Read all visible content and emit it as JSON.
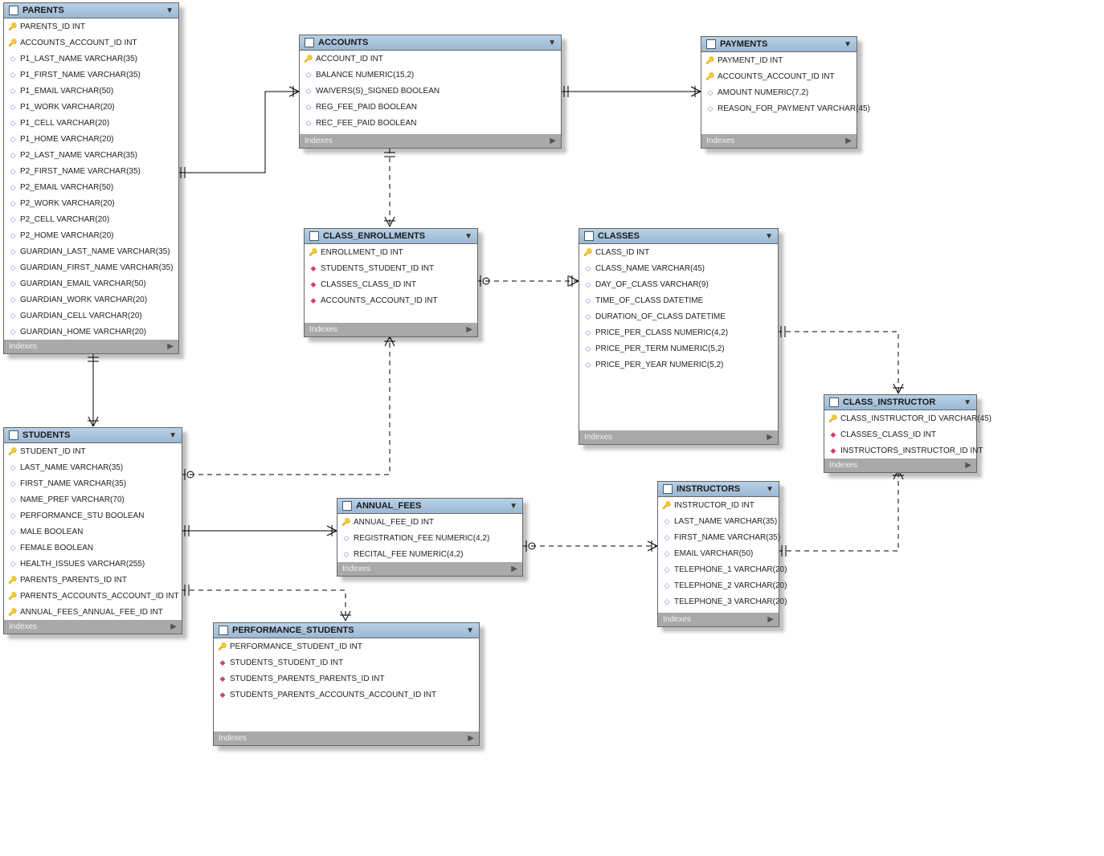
{
  "indexes_label": "Indexes",
  "tables": {
    "parents": {
      "title": "PARENTS",
      "columns": [
        {
          "icon": "pk",
          "label": "PARENTS_ID INT"
        },
        {
          "icon": "fk",
          "label": "ACCOUNTS_ACCOUNT_ID INT"
        },
        {
          "icon": "attr",
          "label": "P1_LAST_NAME VARCHAR(35)"
        },
        {
          "icon": "attr",
          "label": "P1_FIRST_NAME VARCHAR(35)"
        },
        {
          "icon": "attr",
          "label": "P1_EMAIL VARCHAR(50)"
        },
        {
          "icon": "attr",
          "label": "P1_WORK VARCHAR(20)"
        },
        {
          "icon": "attr",
          "label": "P1_CELL VARCHAR(20)"
        },
        {
          "icon": "attr",
          "label": "P1_HOME VARCHAR(20)"
        },
        {
          "icon": "attr",
          "label": "P2_LAST_NAME VARCHAR(35)"
        },
        {
          "icon": "attr",
          "label": "P2_FIRST_NAME VARCHAR(35)"
        },
        {
          "icon": "attr",
          "label": "P2_EMAIL VARCHAR(50)"
        },
        {
          "icon": "attr",
          "label": "P2_WORK VARCHAR(20)"
        },
        {
          "icon": "attr",
          "label": "P2_CELL VARCHAR(20)"
        },
        {
          "icon": "attr",
          "label": "P2_HOME VARCHAR(20)"
        },
        {
          "icon": "attr",
          "label": "GUARDIAN_LAST_NAME VARCHAR(35)"
        },
        {
          "icon": "attr",
          "label": "GUARDIAN_FIRST_NAME VARCHAR(35)"
        },
        {
          "icon": "attr",
          "label": "GUARDIAN_EMAIL VARCHAR(50)"
        },
        {
          "icon": "attr",
          "label": "GUARDIAN_WORK VARCHAR(20)"
        },
        {
          "icon": "attr",
          "label": "GUARDIAN_CELL VARCHAR(20)"
        },
        {
          "icon": "attr",
          "label": "GUARDIAN_HOME VARCHAR(20)"
        }
      ]
    },
    "accounts": {
      "title": "ACCOUNTS",
      "columns": [
        {
          "icon": "pk",
          "label": "ACCOUNT_ID INT"
        },
        {
          "icon": "attr",
          "label": "BALANCE NUMERIC(15,2)"
        },
        {
          "icon": "attr",
          "label": "WAIVERS(S)_SIGNED BOOLEAN"
        },
        {
          "icon": "attr",
          "label": "REG_FEE_PAID BOOLEAN"
        },
        {
          "icon": "attr",
          "label": "REC_FEE_PAID BOOLEAN"
        }
      ]
    },
    "payments": {
      "title": "PAYMENTS",
      "columns": [
        {
          "icon": "pk",
          "label": "PAYMENT_ID INT"
        },
        {
          "icon": "fk",
          "label": "ACCOUNTS_ACCOUNT_ID INT"
        },
        {
          "icon": "attr",
          "label": "AMOUNT NUMERIC(7,2)"
        },
        {
          "icon": "attr",
          "label": "REASON_FOR_PAYMENT VARCHAR(45)"
        }
      ]
    },
    "class_enrollments": {
      "title": "CLASS_ENROLLMENTS",
      "columns": [
        {
          "icon": "pk",
          "label": "ENROLLMENT_ID INT"
        },
        {
          "icon": "fkd",
          "label": "STUDENTS_STUDENT_ID INT"
        },
        {
          "icon": "fkd",
          "label": "CLASSES_CLASS_ID INT"
        },
        {
          "icon": "fkd",
          "label": "ACCOUNTS_ACCOUNT_ID INT"
        }
      ]
    },
    "classes": {
      "title": "CLASSES",
      "columns": [
        {
          "icon": "pk",
          "label": "CLASS_ID INT"
        },
        {
          "icon": "attr",
          "label": "CLASS_NAME VARCHAR(45)"
        },
        {
          "icon": "attr",
          "label": "DAY_OF_CLASS VARCHAR(9)"
        },
        {
          "icon": "attr",
          "label": "TIME_OF_CLASS DATETIME"
        },
        {
          "icon": "attr",
          "label": "DURATION_OF_CLASS DATETIME"
        },
        {
          "icon": "attr",
          "label": "PRICE_PER_CLASS NUMERIC(4,2)"
        },
        {
          "icon": "attr",
          "label": "PRICE_PER_TERM NUMERIC(5,2)"
        },
        {
          "icon": "attr",
          "label": "PRICE_PER_YEAR NUMERIC(5,2)"
        }
      ]
    },
    "class_instructor": {
      "title": "CLASS_INSTRUCTOR",
      "columns": [
        {
          "icon": "pk",
          "label": "CLASS_INSTRUCTOR_ID VARCHAR(45)"
        },
        {
          "icon": "fkd",
          "label": "CLASSES_CLASS_ID INT"
        },
        {
          "icon": "fkd",
          "label": "INSTRUCTORS_INSTRUCTOR_ID INT"
        }
      ]
    },
    "students": {
      "title": "STUDENTS",
      "columns": [
        {
          "icon": "pk",
          "label": "STUDENT_ID INT"
        },
        {
          "icon": "attr",
          "label": "LAST_NAME VARCHAR(35)"
        },
        {
          "icon": "attr",
          "label": "FIRST_NAME VARCHAR(35)"
        },
        {
          "icon": "attr",
          "label": "NAME_PREF VARCHAR(70)"
        },
        {
          "icon": "attr",
          "label": "PERFORMANCE_STU BOOLEAN"
        },
        {
          "icon": "attr",
          "label": "MALE BOOLEAN"
        },
        {
          "icon": "attr",
          "label": "FEMALE BOOLEAN"
        },
        {
          "icon": "attr",
          "label": "HEALTH_ISSUES VARCHAR(255)"
        },
        {
          "icon": "fk",
          "label": "PARENTS_PARENTS_ID INT"
        },
        {
          "icon": "fk",
          "label": "PARENTS_ACCOUNTS_ACCOUNT_ID INT"
        },
        {
          "icon": "fk",
          "label": "ANNUAL_FEES_ANNUAL_FEE_ID INT"
        }
      ]
    },
    "annual_fees": {
      "title": "ANNUAL_FEES",
      "columns": [
        {
          "icon": "pk",
          "label": "ANNUAL_FEE_ID INT"
        },
        {
          "icon": "attr",
          "label": "REGISTRATION_FEE NUMERIC(4,2)"
        },
        {
          "icon": "attr",
          "label": "RECITAL_FEE NUMERIC(4,2)"
        }
      ]
    },
    "instructors": {
      "title": "INSTRUCTORS",
      "columns": [
        {
          "icon": "pk",
          "label": "INSTRUCTOR_ID INT"
        },
        {
          "icon": "attr",
          "label": "LAST_NAME VARCHAR(35)"
        },
        {
          "icon": "attr",
          "label": "FIRST_NAME VARCHAR(35)"
        },
        {
          "icon": "attr",
          "label": "EMAIL VARCHAR(50)"
        },
        {
          "icon": "attr",
          "label": "TELEPHONE_1 VARCHAR(20)"
        },
        {
          "icon": "attr",
          "label": "TELEPHONE_2 VARCHAR(20)"
        },
        {
          "icon": "attr",
          "label": "TELEPHONE_3 VARCHAR(20)"
        }
      ]
    },
    "performance_students": {
      "title": "PERFORMANCE_STUDENTS",
      "columns": [
        {
          "icon": "pk",
          "label": "PERFORMANCE_STUDENT_ID INT"
        },
        {
          "icon": "fkd",
          "label": "STUDENTS_STUDENT_ID INT"
        },
        {
          "icon": "fkd",
          "label": "STUDENTS_PARENTS_PARENTS_ID INT"
        },
        {
          "icon": "fkd",
          "label": "STUDENTS_PARENTS_ACCOUNTS_ACCOUNT_ID INT"
        }
      ]
    }
  }
}
